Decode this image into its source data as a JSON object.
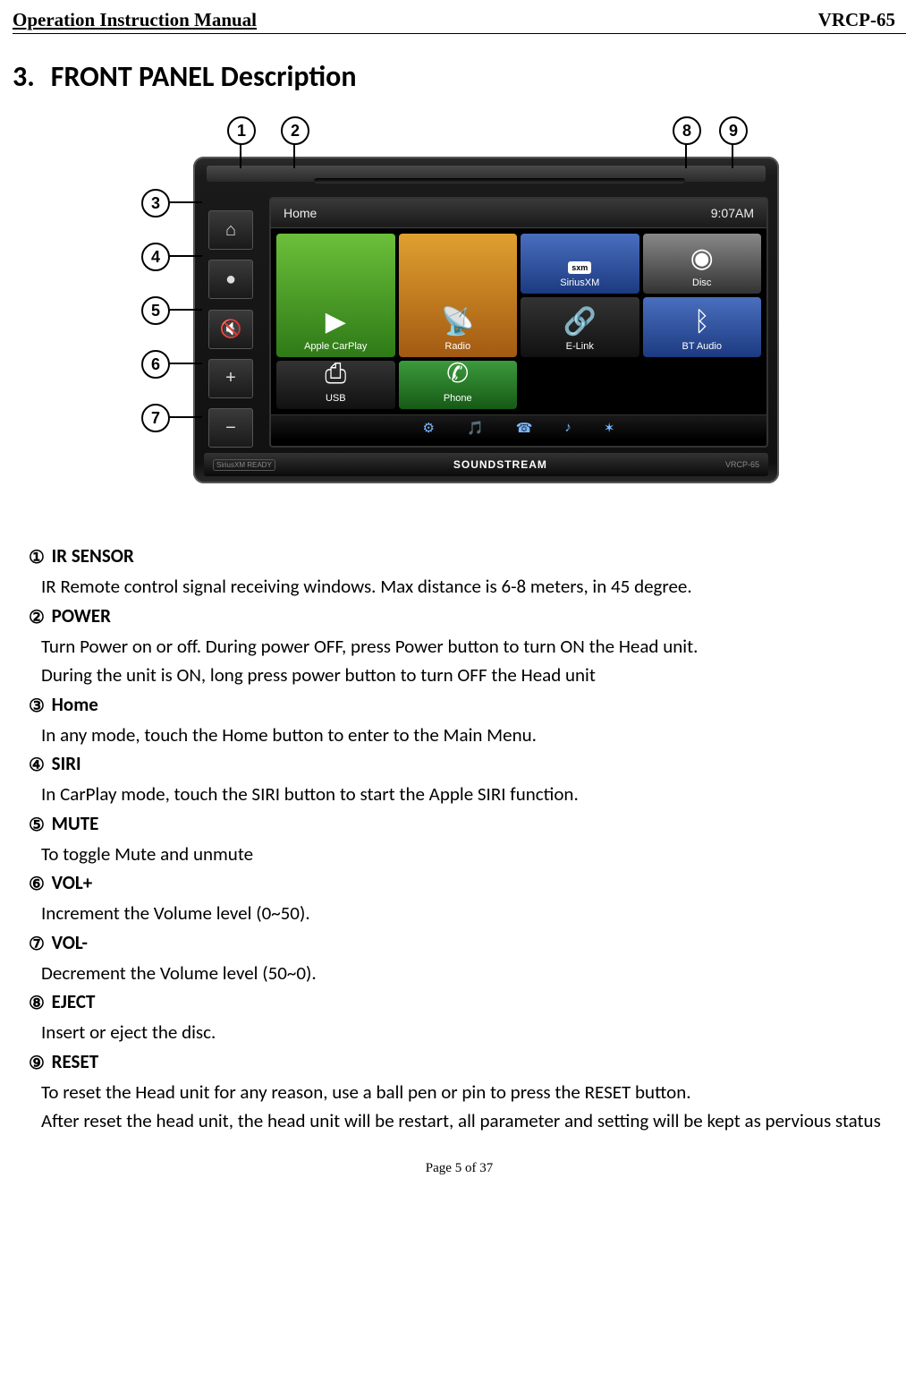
{
  "header": {
    "left": "Operation Instruction Manual",
    "right": "VRCP-65"
  },
  "section": {
    "number": "3.",
    "title": "FRONT PANEL Description"
  },
  "callouts": [
    "1",
    "2",
    "3",
    "4",
    "5",
    "6",
    "7",
    "8",
    "9"
  ],
  "device": {
    "screen_top_left": "Home",
    "screen_top_right": "9:07AM",
    "apps": {
      "carplay": "Apple CarPlay",
      "radio": "Radio",
      "sxm_label": "SiriusXM",
      "sxm_badge": "sxm",
      "disc": "Disc",
      "elink": "E-Link",
      "btaudio": "BT Audio",
      "usb": "USB",
      "phone": "Phone"
    },
    "side_buttons": {
      "home": "⌂",
      "siri": "●",
      "mute": "🔇",
      "plus": "+",
      "minus": "−"
    },
    "bottom_icons": [
      "⚙",
      "🎵",
      "☎",
      "♪",
      "✶"
    ],
    "brand_text": "SOUNDSTREAM",
    "model": "VRCP-65",
    "sirius_badge": "SiriusXM READY"
  },
  "definitions": [
    {
      "n": "①",
      "title": "IR SENSOR",
      "body": [
        "IR Remote control signal receiving windows. Max distance is 6-8 meters, in 45 degree."
      ]
    },
    {
      "n": "②",
      "title": "POWER",
      "body": [
        "Turn Power on or off. During power OFF, press Power button to turn ON the Head unit.",
        "During the unit is ON, long press power button to turn OFF the Head unit"
      ]
    },
    {
      "n": "③",
      "title": "Home",
      "body": [
        "In any mode, touch the Home button to enter to the Main Menu."
      ]
    },
    {
      "n": "④",
      "title": "SIRI",
      "body": [
        "In CarPlay mode, touch the SIRI button to start the Apple SIRI function."
      ]
    },
    {
      "n": "⑤",
      "title": "MUTE",
      "body": [
        "To toggle Mute and unmute"
      ]
    },
    {
      "n": "⑥",
      "title": "VOL+",
      "body": [
        "Increment the Volume level (0~50)."
      ]
    },
    {
      "n": "⑦",
      "title": "VOL-",
      "body": [
        "Decrement the Volume level (50~0)."
      ]
    },
    {
      "n": "⑧",
      "title": "EJECT",
      "body": [
        "Insert or eject the disc."
      ]
    },
    {
      "n": "⑨",
      "title": "RESET",
      "body": [
        "To reset the Head unit for any reason, use a ball pen or pin to press the RESET button.",
        "After reset the head unit, the head unit will be restart, all parameter and setting will be kept as pervious status"
      ]
    }
  ],
  "footer": "Page 5 of 37"
}
